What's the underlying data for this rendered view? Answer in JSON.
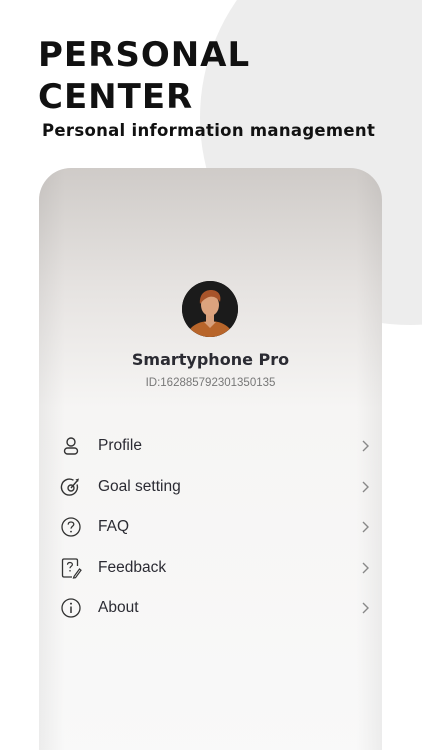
{
  "header": {
    "title": "PERSONAL CENTER",
    "subtitle": "Personal information management"
  },
  "profile": {
    "name": "Smartyphone Pro",
    "id": "ID:162885792301350135"
  },
  "menu": [
    {
      "label": "Profile",
      "icon": "user-icon"
    },
    {
      "label": "Goal setting",
      "icon": "target-icon"
    },
    {
      "label": "FAQ",
      "icon": "question-circle-icon"
    },
    {
      "label": "Feedback",
      "icon": "feedback-edit-icon"
    },
    {
      "label": "About",
      "icon": "info-circle-icon"
    }
  ],
  "colors": {
    "title": "#111111",
    "text": "#2b2b33",
    "secondary_text": "#777777",
    "avatar_bg": "#1b1b1b",
    "avatar_accent": "#b8652a"
  }
}
